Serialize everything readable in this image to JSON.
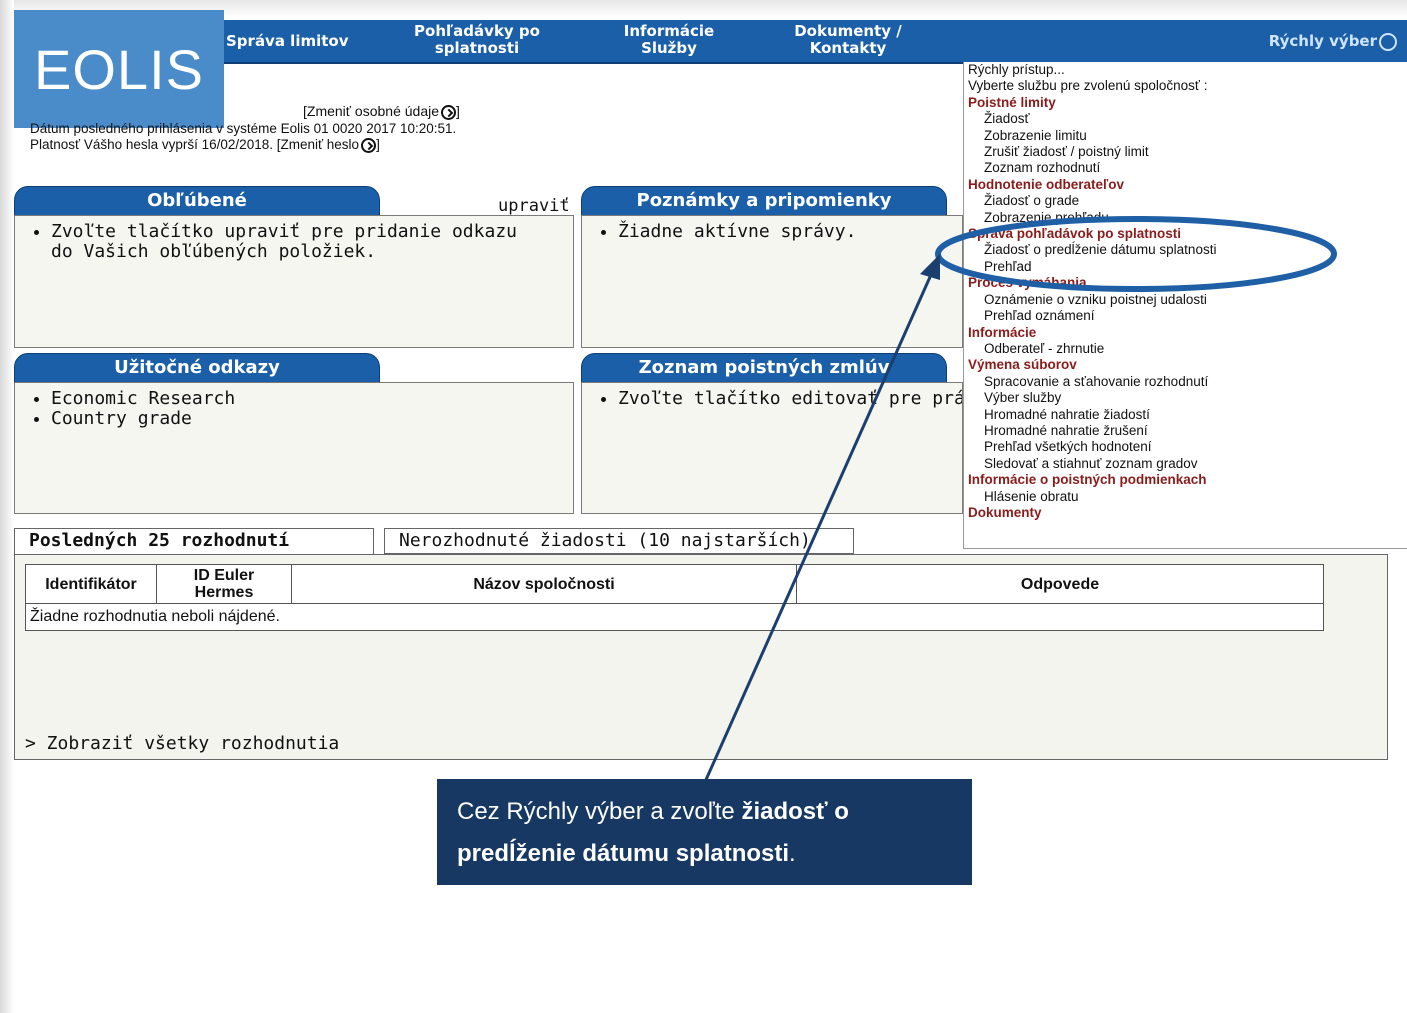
{
  "logo": {
    "text": "EOLIS"
  },
  "nav": {
    "item1": "Správa limitov",
    "item2_line1": "Pohľadávky po",
    "item2_line2": "splatnosti",
    "item3_line1": "Informácie",
    "item3_line2": "Služby",
    "item4_line1": "Dokumenty /",
    "item4_line2": "Kontakty",
    "quick": "Rýchly výber"
  },
  "account": {
    "change_personal": "[Zmeniť osobné údaje",
    "change_personal_end": "]",
    "last_login": "Dátum posledného prihlásenia v systéme Eolis 01 0020 2017 10:20:51.",
    "password_expiry": "Platnosť Vášho hesla vyprší 16/02/2018. [Zmeniť heslo",
    "password_expiry_end": "]"
  },
  "favorites": {
    "title": "Obľúbené",
    "edit": "upraviť",
    "item_line1": "Zvoľte tlačítko upraviť pre pridanie odkazu",
    "item_line2": "do Vašich obľúbených položiek."
  },
  "notes": {
    "title": "Poznámky a pripomienky",
    "item": "Žiadne aktívne správy."
  },
  "links": {
    "title": "Užitočné odkazy",
    "items": [
      "Economic Research",
      "Country grade"
    ]
  },
  "policies": {
    "title": "Zoznam poistných zmlúv",
    "item": "Zvoľte tlačítko editovať pre prá"
  },
  "quick_menu": {
    "line1": "Rýchly prístup...",
    "line2": "Vyberte službu pre zvolenú spoločnosť :",
    "sections": [
      {
        "title": "Poistné limity",
        "items": [
          "Žiadosť",
          "Zobrazenie limitu",
          "Zrušiť žiadosť / poistný limit",
          "Zoznam rozhodnutí"
        ]
      },
      {
        "title": "Hodnotenie odberateľov",
        "items": [
          "Žiadosť o grade",
          "Zobrazenie prehľadu"
        ]
      },
      {
        "title": "Správa pohľadávok po splatnosti",
        "items": [
          "Žiadosť o predĺženie dátumu splatnosti",
          "Prehľad"
        ]
      },
      {
        "title": "Proces vymáhania",
        "items": [
          "Oznámenie o vzniku poistnej udalosti",
          "Prehľad oznámení"
        ]
      },
      {
        "title": "Informácie",
        "items": [
          "Odberateľ - zhrnutie"
        ]
      },
      {
        "title": "Výmena súborov",
        "items": [
          "Spracovanie a sťahovanie rozhodnutí",
          "Výber služby",
          "Hromadné nahratie žiadostí",
          "Hromadné nahratie žrušení",
          "Prehľad všetkých hodnotení",
          "Sledovať a stiahnuť zoznam gradov"
        ]
      },
      {
        "title": "Informácie o poistných podmienkach",
        "items": [
          "Hlásenie obratu"
        ]
      },
      {
        "title": "Dokumenty",
        "items": []
      }
    ]
  },
  "decisions": {
    "tab_active": "Posledných 25 rozhodnutí",
    "tab_other": "Nerozhodnuté žiadosti (10 najstarších)",
    "columns": {
      "c1": "Identifikátor",
      "c2_line1": "ID Euler",
      "c2_line2": "Hermes",
      "c3": "Názov spoločnosti",
      "c4": "Odpovede"
    },
    "empty": "Žiadne rozhodnutia neboli nájdené.",
    "show_all": "> Zobraziť všetky rozhodnutia"
  },
  "callout": {
    "part1": "Cez Rýchly výber a zvoľte ",
    "bold1": "žiadosť o",
    "bold2": "predĺženie dátumu splatnosti",
    "end": "."
  }
}
